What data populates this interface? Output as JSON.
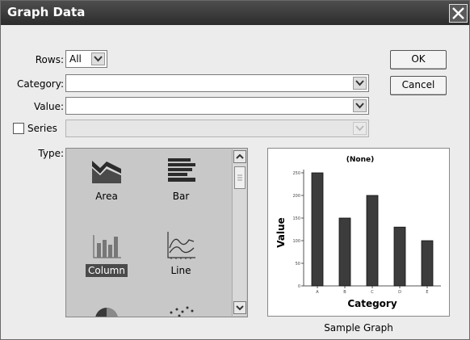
{
  "dialog": {
    "title": "Graph Data",
    "close_icon": "close-icon"
  },
  "form": {
    "rows_label": "Rows:",
    "rows_value": "All",
    "category_label": "Category:",
    "category_value": "",
    "value_label": "Value:",
    "value_value": "",
    "series_label": "Series",
    "series_checked": false,
    "series_value": "",
    "type_label": "Type:"
  },
  "buttons": {
    "ok": "OK",
    "cancel": "Cancel"
  },
  "graph_types": [
    {
      "label": "Area",
      "icon": "area-chart-icon",
      "selected": false
    },
    {
      "label": "Bar",
      "icon": "bar-chart-icon",
      "selected": false
    },
    {
      "label": "Column",
      "icon": "column-chart-icon",
      "selected": true
    },
    {
      "label": "Line",
      "icon": "line-chart-icon",
      "selected": false
    },
    {
      "label": "",
      "icon": "pie-chart-icon",
      "selected": false
    },
    {
      "label": "",
      "icon": "scatter-chart-icon",
      "selected": false
    }
  ],
  "preview": {
    "caption": "Sample Graph"
  },
  "chart_data": {
    "type": "bar",
    "title": "(None)",
    "xlabel": "Category",
    "ylabel": "Value",
    "categories": [
      "A",
      "B",
      "C",
      "D",
      "E"
    ],
    "values": [
      250,
      150,
      200,
      130,
      100
    ],
    "ylim": [
      0,
      250
    ],
    "yticks": [
      0,
      50,
      100,
      150,
      200,
      250
    ],
    "bar_color": "#3c3c3c",
    "grid": false
  },
  "colors": {
    "titlebar": "#3c3c3c",
    "dialog_bg": "#ececec",
    "type_list_bg": "#c8c8c8",
    "selection": "#4a4a4a"
  }
}
